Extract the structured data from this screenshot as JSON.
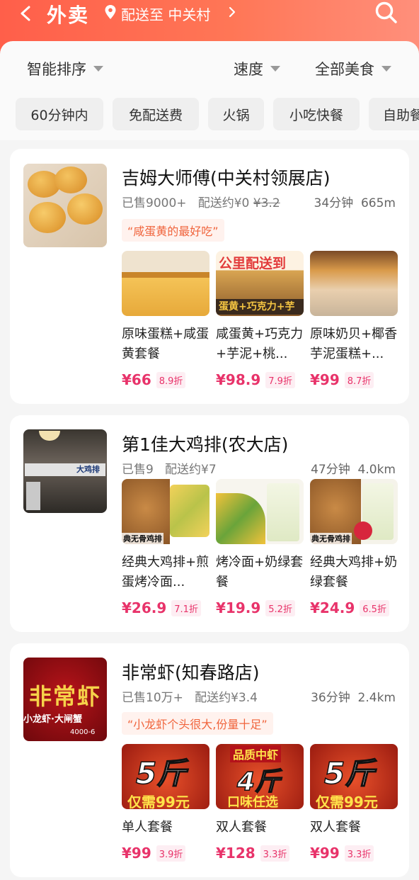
{
  "header": {
    "title": "外卖",
    "location": "配送至 中关村",
    "gradient": [
      "#ff5f4a",
      "#ff8f7b"
    ],
    "icons": [
      "back-icon",
      "location-pin-icon",
      "chevron-right-icon",
      "search-icon"
    ]
  },
  "filters": {
    "sorts": [
      "智能排序",
      "速度",
      "全部美食"
    ],
    "chips": [
      "60分钟内",
      "免配送费",
      "火锅",
      "小吃快餐",
      "自助餐"
    ]
  },
  "stores": [
    {
      "name": "吉姆大师傅(中关村领展店)",
      "sold": "已售9000+",
      "delivery": "配送约¥0",
      "delivery_orig": "¥3.2",
      "time": "34分钟",
      "distance": "665m",
      "tag": "“咸蛋黄的最好吃”",
      "image": "egg-yolk-pastries-image",
      "dishes": [
        {
          "name": "原味蛋糕+咸蛋黄套餐",
          "price": "¥66",
          "discount": "8.9折",
          "image": "sponge-cake-image"
        },
        {
          "name": "咸蛋黄+巧克力+芋泥+桃...",
          "price": "¥98.9",
          "discount": "7.9折",
          "image": "cake-promo-image",
          "img_top": "公里配送到",
          "img_bottom": "蛋黄+巧克力+芋"
        },
        {
          "name": "原味奶贝+椰香芋泥蛋糕+...",
          "price": "¥99",
          "discount": "8.7折",
          "image": "taro-cake-image"
        }
      ]
    },
    {
      "name": "第1佳大鸡排(农大店)",
      "sold": "已售9",
      "delivery": "配送约¥7",
      "time": "47分钟",
      "distance": "4.0km",
      "image": "storefront-image",
      "store_sign": "大鸡排",
      "dishes": [
        {
          "name": "经典大鸡排+煎蛋烤冷面...",
          "price": "¥26.9",
          "discount": "7.1折",
          "image": "chicken-cutlet-image",
          "img_label": "典无骨鸡排"
        },
        {
          "name": "烤冷面+奶绿套餐",
          "price": "¥19.9",
          "discount": "5.2折",
          "image": "cold-noodle-drink-image"
        },
        {
          "name": "经典大鸡排+奶绿套餐",
          "price": "¥24.9",
          "discount": "6.5折",
          "image": "chicken-drink-image",
          "img_label": "典无骨鸡排"
        }
      ]
    },
    {
      "name": "非常虾(知春路店)",
      "sold": "已售10万+",
      "delivery": "配送约¥3.4",
      "time": "36分钟",
      "distance": "2.4km",
      "tag": "“小龙虾个头很大,份量十足”",
      "image": "crayfish-logo-image",
      "logo_text": "非常虾",
      "logo_sub": "小龙虾·大闸蟹",
      "logo_phone": "4000-6",
      "dishes": [
        {
          "name": "单人套餐",
          "price": "¥99",
          "discount": "3.9折",
          "image": "crayfish-5jin-image",
          "img_big": "5斤",
          "img_small": "仅需99元"
        },
        {
          "name": "双人套餐",
          "price": "¥128",
          "discount": "3.3折",
          "image": "crayfish-4jin-image",
          "img_top": "品质中虾",
          "img_big": "4斤",
          "img_small": "口味任选"
        },
        {
          "name": "双人套餐",
          "price": "¥99",
          "discount": "3.3折",
          "image": "crayfish-5jin-image",
          "img_big": "5斤",
          "img_small": "仅需99元"
        }
      ]
    }
  ]
}
